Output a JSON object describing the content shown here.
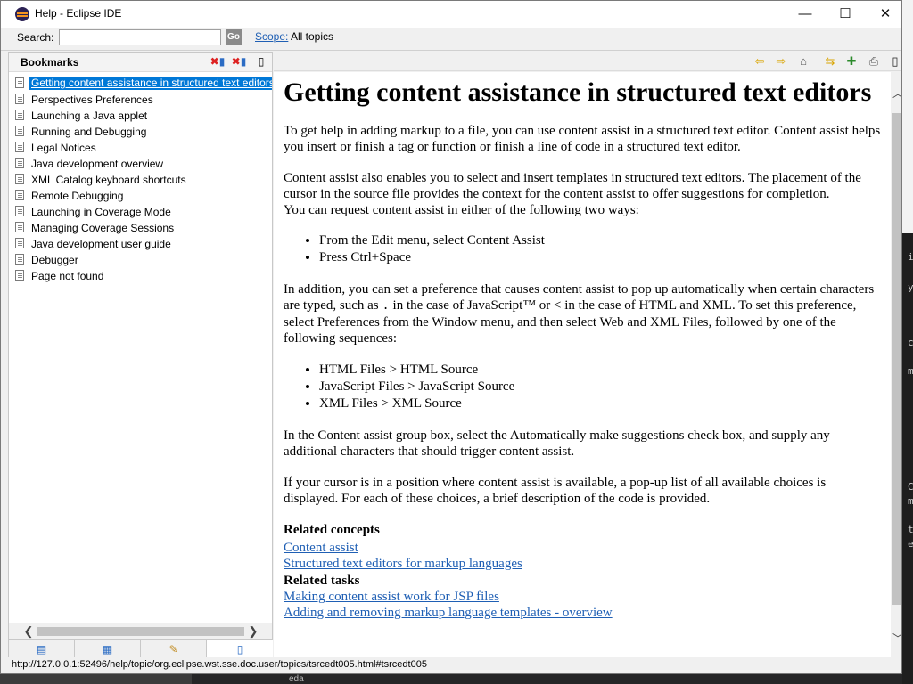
{
  "window": {
    "title": "Help - Eclipse IDE",
    "minimize_glyph": "—",
    "maximize_glyph": "☐",
    "close_glyph": "✕"
  },
  "search": {
    "label": "Search:",
    "value": "",
    "go_label": "Go",
    "scope_link": "Scope:",
    "scope_value": "All topics"
  },
  "bookmarks": {
    "title": "Bookmarks",
    "items": [
      "Getting content assistance in structured text editors",
      "Perspectives Preferences",
      "Launching a Java applet",
      "Running and Debugging",
      "Legal Notices",
      "Java development overview",
      "XML Catalog keyboard shortcuts",
      "Remote Debugging",
      "Launching in Coverage Mode",
      "Managing Coverage Sessions",
      "Java development user guide",
      "Debugger",
      "Page not found"
    ]
  },
  "article": {
    "title": "Getting content assistance in structured text editors",
    "p1": "To get help in adding markup to a file, you can use content assist in a structured text editor. Content assist helps you insert or finish a tag or function or finish a line of code in a structured text editor.",
    "p2": "Content assist also enables you to select and insert templates in structured text editors. The placement of the cursor in the source file provides the context for the content assist to offer suggestions for completion.",
    "p3": "You can request content assist in either of the following two ways:",
    "ways": [
      "From the Edit menu, select Content Assist",
      "Press Ctrl+Space"
    ],
    "p4a": "In addition, you can set a preference that causes content assist to pop up automatically when certain characters are typed, such as ",
    "p4code": ".",
    "p4b": " in the case of JavaScript™ or < in the case of HTML and XML. To set this preference, select Preferences from the Window menu, and then select Web and XML Files, followed by one of the following sequences:",
    "sequences": [
      "HTML Files > HTML Source",
      "JavaScript Files > JavaScript Source",
      "XML Files > XML Source"
    ],
    "p5": "In the Content assist group box, select the Automatically make suggestions check box, and supply any additional characters that should trigger content assist.",
    "p6": "If your cursor is in a position where content assist is available, a pop-up list of all available choices is displayed. For each of these choices, a brief description of the code is provided.",
    "related_concepts_heading": "Related concepts",
    "related_concepts": [
      "Content assist",
      "Structured text editors for markup languages"
    ],
    "related_tasks_heading": "Related tasks",
    "related_tasks": [
      "Making content assist work for JSP files",
      "Adding and removing markup language templates - overview"
    ]
  },
  "status": {
    "url": "http://127.0.0.1:52496/help/topic/org.eclipse.wst.sse.doc.user/topics/tsrcedt005.html#tsrcedt005"
  },
  "background": {
    "taskbar_text": "eda",
    "right_chars": [
      "i",
      "y",
      "c",
      "m",
      "C",
      "m",
      "t",
      "e"
    ]
  }
}
